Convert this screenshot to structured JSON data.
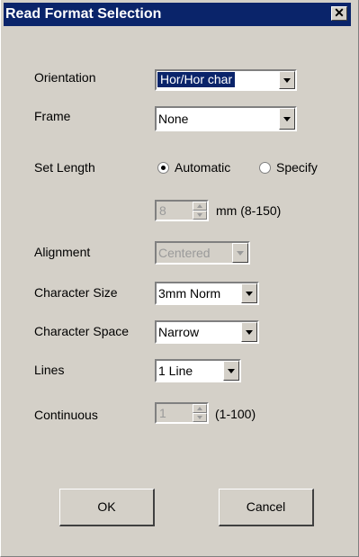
{
  "window": {
    "title": "Read Format Selection"
  },
  "fields": {
    "orientation": {
      "label": "Orientation",
      "value": "Hor/Hor char"
    },
    "frame": {
      "label": "Frame",
      "value": "None"
    },
    "set_length": {
      "label": "Set Length",
      "option_automatic": "Automatic",
      "option_specify": "Specify",
      "selected": "Automatic"
    },
    "length_value": {
      "value": "8",
      "unit": "mm (8-150)"
    },
    "alignment": {
      "label": "Alignment",
      "value": "Centered"
    },
    "character_size": {
      "label": "Character Size",
      "value": "3mm Norm"
    },
    "character_space": {
      "label": "Character Space",
      "value": "Narrow"
    },
    "lines": {
      "label": "Lines",
      "value": "1 Line"
    },
    "continuous": {
      "label": "Continuous",
      "value": "1",
      "range": "(1-100)"
    }
  },
  "buttons": {
    "ok": "OK",
    "cancel": "Cancel"
  },
  "colors": {
    "titlebar": "#0a246a",
    "face": "#d4d0c8",
    "disabled_text": "#9a9a9a"
  }
}
